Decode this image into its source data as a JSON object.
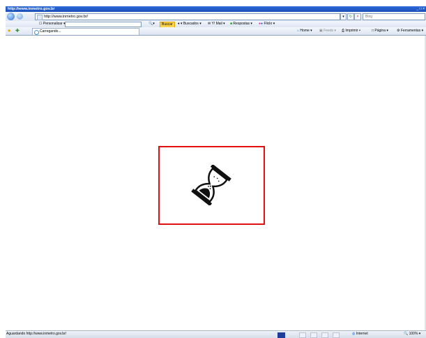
{
  "window": {
    "title": "http://www.inmetro.gov.br",
    "controls": "_ □ ×"
  },
  "address_bar": {
    "url": "http://www.inmetro.gov.br/",
    "search_placeholder": "Bing"
  },
  "links_bar": {
    "personalize": "Personalizar",
    "buscar": "Buscar",
    "buscados": "Buscados",
    "mail": "Y! Mail",
    "respostas": "Respostas",
    "flickr": "Flickr"
  },
  "tab": {
    "label": "Carregando..."
  },
  "command_bar": {
    "home": "Home",
    "feeds": "Feeds",
    "imprimir": "Imprimir",
    "pagina": "Página",
    "ferramentas": "Ferramentas"
  },
  "status_bar": {
    "status_text": "Aguardando http://www.inmetro.gov.br/",
    "zone": "Internet",
    "zoom": "100%",
    "progress_fraction": 0.1
  },
  "colors": {
    "loader_border": "#e01010",
    "titlebar": "#1f5cc8"
  },
  "icons": [
    "back-arrow-icon",
    "forward-arrow-icon",
    "refresh-icon",
    "stop-icon",
    "search-icon",
    "favorites-star-icon",
    "loading-spinner-icon",
    "hourglass-icon",
    "home-icon",
    "internet-globe-icon"
  ]
}
